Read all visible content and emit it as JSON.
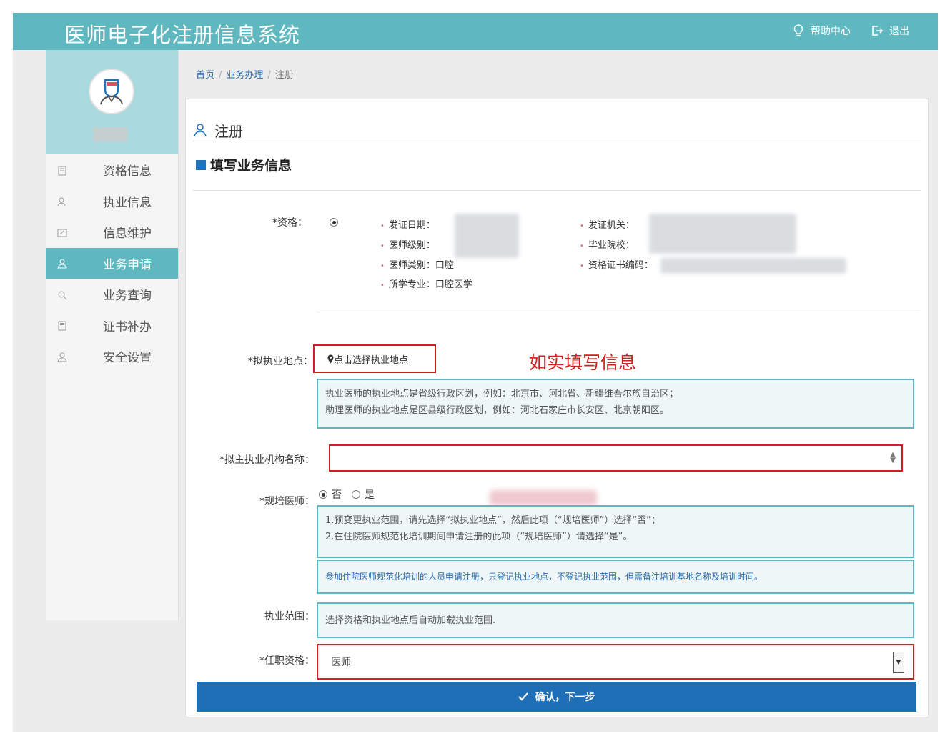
{
  "app": {
    "title": "医师电子化注册信息系统"
  },
  "header": {
    "help_label": "帮助中心",
    "logout_label": "退出"
  },
  "sidebar": {
    "items": [
      {
        "label": "资格信息",
        "icon": "document-icon"
      },
      {
        "label": "执业信息",
        "icon": "user-id-icon"
      },
      {
        "label": "信息维护",
        "icon": "edit-icon"
      },
      {
        "label": "业务申请",
        "icon": "user-icon",
        "active": true
      },
      {
        "label": "业务查询",
        "icon": "search-list-icon"
      },
      {
        "label": "证书补办",
        "icon": "certificate-icon"
      },
      {
        "label": "安全设置",
        "icon": "lock-user-icon"
      }
    ]
  },
  "breadcrumb": {
    "home": "首页",
    "section": "业务办理",
    "current": "注册"
  },
  "panel": {
    "heading": "注册",
    "section_title": "填写业务信息"
  },
  "form": {
    "qualification_label": "*资格：",
    "qualification": {
      "issue_date_label": "发证日期：",
      "level_label": "医师级别：",
      "category_label": "医师类别：口腔",
      "major_label": "所学专业：口腔医学",
      "authority_label": "发证机关：",
      "school_label": "毕业院校：",
      "cert_no_label": "资格证书编码："
    },
    "location_label": "*拟执业地点：",
    "location_button": "点击选择执业地点",
    "annotation": "如实填写信息",
    "location_hint_1": "执业医师的执业地点是省级行政区划，例如：北京市、河北省、新疆维吾尔族自治区；",
    "location_hint_2": "助理医师的执业地点是区县级行政区划，例如：河北石家庄市长安区、北京朝阳区。",
    "org_label": "*拟主执业机构名称：",
    "resident_label": "*规培医师：",
    "resident_no": "否",
    "resident_yes": "是",
    "resident_hint_1": "1.预变更执业范围，请先选择“拟执业地点”，然后此项（“规培医师”）选择“否”；",
    "resident_hint_2": "2.在住院医师规范化培训期间申请注册的此项（“规培医师”）请选择“是”。",
    "resident_note": "参加住院医师规范化培训的人员申请注册，只登记执业地点，不登记执业范围，但需备注培训基地名称及培训时间。",
    "scope_label": "执业范围：",
    "scope_text": "选择资格和执业地点后自动加载执业范围.",
    "title_label": "*任职资格：",
    "title_value": "医师",
    "submit_label": "确认，下一步"
  }
}
